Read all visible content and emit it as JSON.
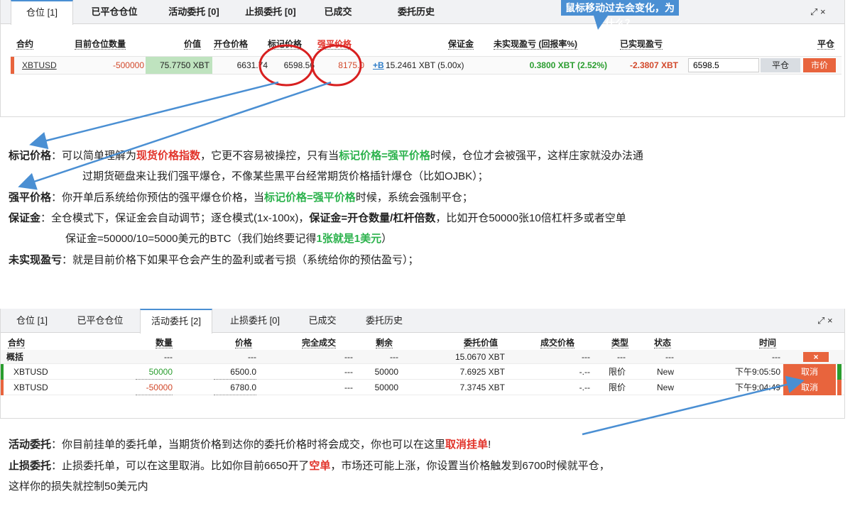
{
  "top_panel": {
    "tabs": [
      "仓位 [1]",
      "已平仓仓位",
      "活动委托 [0]",
      "止损委托 [0]",
      "已成交",
      "委托历史"
    ],
    "headers": {
      "symbol": "合约",
      "qty": "目前仓位数量",
      "value": "价值",
      "entry": "开仓价格",
      "mark": "标记价格",
      "liq": "强平价格",
      "margin": "保证金",
      "upnl": "未实现盈亏 (回报率%)",
      "rpnl": "已实现盈亏",
      "close": "平仓"
    },
    "row": {
      "symbol": "XBTUSD",
      "qty": "-500000",
      "value": "75.7750 XBT",
      "entry": "6631.74",
      "mark": "6598.56",
      "liq": "8175.0",
      "margin_prefix": "+B",
      "margin": "15.2461 XBT (5.00x)",
      "upnl": "0.3800 XBT (2.52%)",
      "rpnl": "-2.3807 XBT",
      "close_price_value": "6598.5",
      "close_btn": "平仓",
      "market_btn": "市价"
    },
    "window_controls": "⤢ ×"
  },
  "callout": "鼠标移动过去会变化，为什么？",
  "notes_top": [
    {
      "label": "标记价格",
      "sep": "：",
      "a": "可以简单理解为",
      "r1": "现货价格指数",
      "b": "，它更不容易被操控，只有当",
      "g1": "标记价格=强平价格",
      "c": "时候，仓位才会被强平，这样庄家就没办法通"
    },
    {
      "indent": "过期货砸盘来让我们强平爆仓，不像某些黑平台经常期货价格插针爆仓（比如OJBK）；"
    },
    {
      "label": "强平价格",
      "sep": "：",
      "a": "你开单后系统给你预估的强平爆仓价格，当",
      "g1": "标记价格=强平价格",
      "c": "时候，系统会强制平仓；"
    },
    {
      "label": "保证金",
      "sep": "：",
      "a": "全仓模式下，保证金会自动调节；逐仓模式(1x-100x)，",
      "b1": "保证金=开仓数量/杠杆倍数",
      "c": "，比如开仓50000张10倍杠杆多或者空单"
    },
    {
      "indent": "保证金=50000/10=5000美元的BTC（我们始终要记得",
      "g1": "1张就是1美元",
      "tail": "）"
    },
    {
      "label": "未实现盈亏",
      "sep": "：",
      "a": "就是目前价格下如果平仓会产生的盈利或者亏损（系统给你的预估盈亏）；"
    }
  ],
  "bottom_panel": {
    "tabs": [
      "仓位 [1]",
      "已平仓仓位",
      "活动委托 [2]",
      "止损委托 [0]",
      "已成交",
      "委托历史"
    ],
    "headers": [
      "合约",
      "数量",
      "价格",
      "完全成交",
      "剩余",
      "委托价值",
      "成交价格",
      "类型",
      "状态",
      "时间"
    ],
    "summary": {
      "label": "概括",
      "qty": "---",
      "price": "---",
      "filled": "---",
      "remain": "---",
      "value": "15.0670 XBT",
      "fill_price": "---",
      "type": "---",
      "status": "---",
      "time": "---",
      "cancel_all": "×"
    },
    "orders": [
      {
        "symbol": "XBTUSD",
        "qty": "50000",
        "price": "6500.0",
        "filled": "---",
        "remain": "50000",
        "value": "7.6925 XBT",
        "fill_price": "-.--",
        "type": "限价",
        "status": "New",
        "time": "下午9:05:50",
        "cancel": "取消"
      },
      {
        "symbol": "XBTUSD",
        "qty": "-50000",
        "price": "6780.0",
        "filled": "---",
        "remain": "50000",
        "value": "7.3745 XBT",
        "fill_price": "-.--",
        "type": "限价",
        "status": "New",
        "time": "下午9:04:49",
        "cancel": "取消"
      }
    ]
  },
  "notes_bottom": [
    {
      "label": "活动委托",
      "sep": "：",
      "a": "你目前挂单的委托单，当期货价格到达你的委托价格时将会成交，你也可以在这里",
      "r1": "取消挂单",
      "c": "!"
    },
    {
      "label": "止损委托",
      "sep": "：",
      "a": "止损委托单，可以在这里取消。比如你目前6650开了",
      "r1": "空单",
      "c": "，市场还可能上涨，你设置当价格触发到6700时候就平仓，"
    },
    {
      "indent": "这样你的损失就控制50美元内"
    }
  ],
  "colors": {
    "accent": "#4a8fd3",
    "negative": "#d2482a",
    "positive": "#2a9d2f",
    "highlight_green": "#2bb24c",
    "highlight_red": "#e2332a",
    "circle": "#d81f1f"
  }
}
